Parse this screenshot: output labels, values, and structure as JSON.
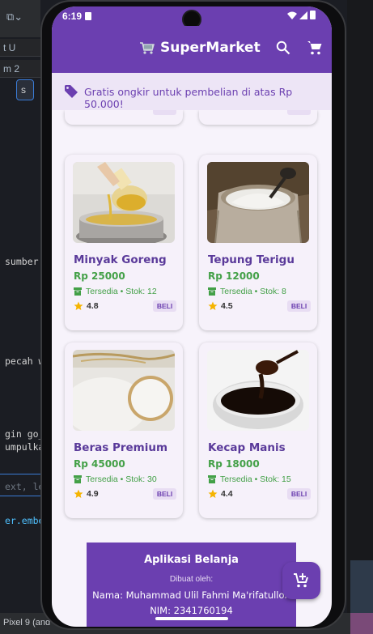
{
  "ide": {
    "tab1": "t U",
    "tab2": "m 2",
    "selector": "s",
    "code_lines": [
      "sumber",
      "pecah w",
      "gin go_",
      "umpulka",
      "ext, lexclu",
      "er.embe"
    ],
    "status": "Pixel 9 (and"
  },
  "status_bar": {
    "time": "6:19"
  },
  "app_bar": {
    "title": "SuperMarket",
    "search_icon": "search-icon",
    "cart_icon": "cart-icon"
  },
  "banner": {
    "icon": "tag-icon",
    "text": "Gratis ongkir untuk pembelian di atas Rp 50.000!"
  },
  "products": [
    {
      "name": "Minyak Goreng",
      "price": "Rp 25000",
      "stock": "Tersedia • Stok: 12",
      "rating": "4.8",
      "buy": "BELI",
      "image": "cooking-oil-image"
    },
    {
      "name": "Tepung Terigu",
      "price": "Rp 12000",
      "stock": "Tersedia • Stok: 8",
      "rating": "4.5",
      "buy": "BELI",
      "image": "flour-image"
    },
    {
      "name": "Beras Premium",
      "price": "Rp 45000",
      "stock": "Tersedia • Stok: 30",
      "rating": "4.9",
      "buy": "BELI",
      "image": "rice-image"
    },
    {
      "name": "Kecap Manis",
      "price": "Rp 18000",
      "stock": "Tersedia • Stok: 15",
      "rating": "4.4",
      "buy": "BELI",
      "image": "soy-sauce-image"
    }
  ],
  "footer": {
    "title": "Aplikasi Belanja",
    "by_label": "Dibuat oleh:",
    "name": "Nama: Muhammad Ulil Fahmi Ma'rifatulloh",
    "nim": "NIM: 2341760194"
  },
  "fab": {
    "icon": "add-shopping-cart-icon"
  },
  "colors": {
    "primary": "#6b3fb0",
    "banner_bg": "#ede5f6",
    "price_green": "#43a047",
    "card_bg": "#f6f1fa",
    "star": "#f5b400"
  }
}
